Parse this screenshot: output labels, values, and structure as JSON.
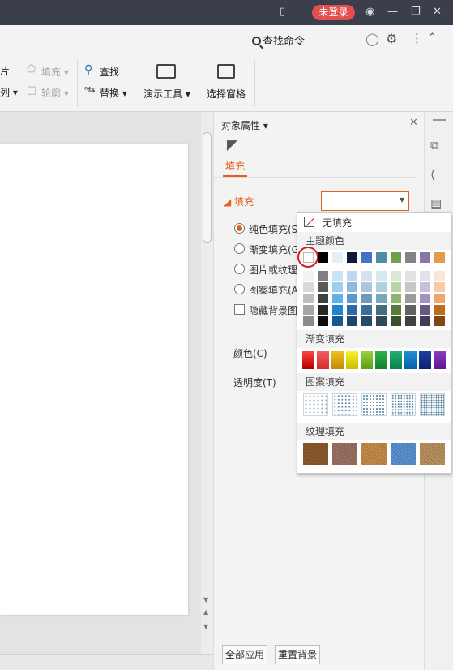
{
  "titlebar": {
    "login_label": "未登录",
    "bg": "#3b3f4b"
  },
  "cmdbar": {
    "search_label": "查找命令"
  },
  "ribbon": {
    "picture_label": "片",
    "arrange_label": "列 ▾",
    "fill_label": "填充 ▾",
    "outline_label": "轮廓 ▾",
    "find_label": "查找",
    "replace_label": "替换 ▾",
    "present_tool_label": "演示工具 ▾",
    "select_pane_label": "选择窗格"
  },
  "pane": {
    "title": "对象属性 ▾",
    "tab_fill": "填充",
    "section_fill": "◢ 填充",
    "options": [
      {
        "label": "纯色填充(S",
        "selected": true
      },
      {
        "label": "渐变填充(G",
        "selected": false
      },
      {
        "label": "图片或纹理",
        "selected": false
      },
      {
        "label": "图案填充(A",
        "selected": false
      }
    ],
    "hide_bg_label": "隐藏背景图",
    "color_label": "颜色(C)",
    "transparency_label": "透明度(T)",
    "apply_all_label": "全部应用",
    "reset_bg_label": "重置背景"
  },
  "dropdown": {
    "no_fill_label": "无填充",
    "theme_colors_label": "主题颜色",
    "gradient_label": "渐变填充",
    "pattern_label": "图案填充",
    "texture_label": "纹理填充",
    "theme_top": [
      "#ffffff",
      "#000000",
      "#e7eef7",
      "#0d1b3a",
      "#4472c4",
      "#4a8fa3",
      "#6fa04a",
      "#838383",
      "#8877a6",
      "#e6984e"
    ],
    "theme_shades": [
      [
        "#f2f2f2",
        "#d9d9d9",
        "#bfbfbf",
        "#a6a6a6",
        "#8c8c8c"
      ],
      [
        "#7f7f7f",
        "#595959",
        "#404040",
        "#262626",
        "#0d0d0d"
      ],
      [
        "#c9e4f7",
        "#9ecff0",
        "#5db3e8",
        "#1f86cc",
        "#155a8a"
      ],
      [
        "#bfd6ec",
        "#8fb9df",
        "#5a97cc",
        "#2c6aa6",
        "#1d466e"
      ],
      [
        "#d5e2ed",
        "#aac6dc",
        "#6c9bbf",
        "#3c6e94",
        "#284a63"
      ],
      [
        "#d7e8ec",
        "#afd1d9",
        "#77a8b5",
        "#466e7a",
        "#2f4a52"
      ],
      [
        "#dbe9d2",
        "#b8d4a6",
        "#8bb56c",
        "#577a3a",
        "#3a5227"
      ],
      [
        "#e2e2e2",
        "#c6c6c6",
        "#9b9b9b",
        "#626262",
        "#414141"
      ],
      [
        "#e3dfec",
        "#c7bfd9",
        "#a094bc",
        "#665982",
        "#443b57"
      ],
      [
        "#fae6d4",
        "#f5cba8",
        "#eea66a",
        "#c06a1c",
        "#804613"
      ]
    ],
    "gradients": [
      [
        "#ff4444",
        "#b20000"
      ],
      [
        "#f25c5c",
        "#d92b2b"
      ],
      [
        "#f0c020",
        "#c08a00"
      ],
      [
        "#f5f02a",
        "#c8c000"
      ],
      [
        "#9ad040",
        "#5c9c14"
      ],
      [
        "#2fb04a",
        "#118030"
      ],
      [
        "#20b070",
        "#0a8050"
      ],
      [
        "#1e8fd8",
        "#0a5fa8"
      ],
      [
        "#2040a8",
        "#0a2070"
      ],
      [
        "#8a3cc0",
        "#5c1890"
      ]
    ],
    "patterns": [
      "#8fa6ba",
      "#6a8fb0",
      "#5c86a8",
      "#5c8aa8",
      "#4f7e9c"
    ],
    "textures": [
      "#8b5a2b",
      "#9a7060",
      "#c48a4a",
      "#5a8fd0",
      "#b8905c"
    ],
    "selection_ring": "#d42020"
  }
}
